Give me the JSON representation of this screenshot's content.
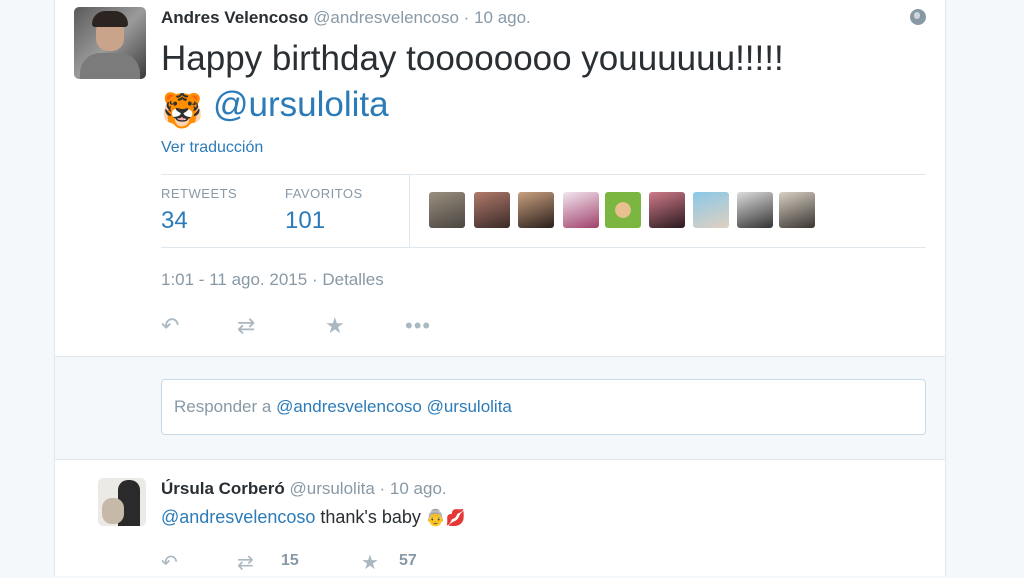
{
  "tweet": {
    "author_name": "Andres Velencoso",
    "author_handle": "@andresvelencoso",
    "separator": "·",
    "time": "10 ago.",
    "text": "Happy birthday toooooooo youuuuuu!!!!!",
    "emoji": "🐯",
    "mention": "@ursulolita",
    "translate_label": "Ver traducción",
    "retweets_label": "RETWEETS",
    "retweets_count": "34",
    "favorites_label": "FAVORITOS",
    "favorites_count": "101",
    "datetime": "1:01 - 11 ago. 2015",
    "details_label": "Detalles",
    "favoriter_avatars": [
      "avatar-1",
      "avatar-2",
      "avatar-3",
      "avatar-4",
      "avatar-5",
      "avatar-6",
      "avatar-7",
      "avatar-8",
      "avatar-9"
    ],
    "actions": {
      "reply_icon": "reply-icon",
      "retweet_icon": "retweet-icon",
      "favorite_icon": "star-icon",
      "more_icon": "more-icon"
    }
  },
  "reply_box": {
    "prefix": "Responder a",
    "mentions": "@andresvelencoso @ursulolita"
  },
  "reply": {
    "author_name": "Úrsula Corberó",
    "author_handle": "@ursulolita",
    "separator": "·",
    "time": "10 ago.",
    "mention": "@andresvelencoso",
    "text": "thank's baby",
    "emojis": "👵💋",
    "retweets_count": "15",
    "favorites_count": "57"
  },
  "colors": {
    "link": "#2b7bb9",
    "muted": "#8899a6",
    "text": "#292f33",
    "border": "#e1e8ed",
    "background": "#f5f8fa"
  }
}
